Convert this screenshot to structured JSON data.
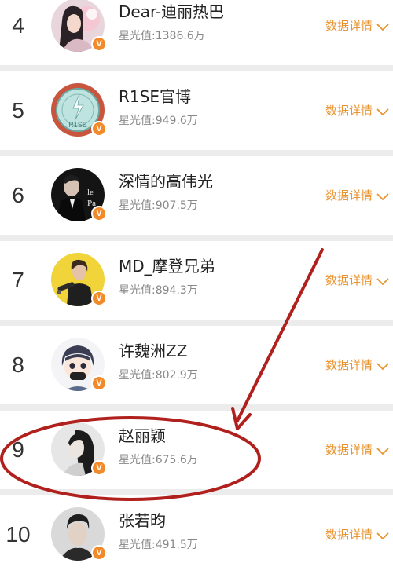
{
  "colors": {
    "accent": "#e8932e",
    "verified_badge": "#f28a2a",
    "annotation_red": "#b0201c",
    "row_bg": "#ffffff",
    "separator": "#ececec"
  },
  "list": {
    "items": [
      {
        "rank": "4",
        "name": "Dear-迪丽热巴",
        "stat_label": "星光值:",
        "stat_value": "1386.6万",
        "details_label": "数据详情",
        "verified": "V",
        "avatar_icon": "avatar-portrait-female"
      },
      {
        "rank": "5",
        "name": "R1SE官博",
        "stat_label": "星光值:",
        "stat_value": "949.6万",
        "details_label": "数据详情",
        "verified": "V",
        "avatar_icon": "avatar-logo-r1se",
        "avatar_text": "R1SE"
      },
      {
        "rank": "6",
        "name": "深情的高伟光",
        "stat_label": "星光值:",
        "stat_value": "907.5万",
        "details_label": "数据详情",
        "verified": "V",
        "avatar_icon": "avatar-poster-man"
      },
      {
        "rank": "7",
        "name": "MD_摩登兄弟",
        "stat_label": "星光值:",
        "stat_value": "894.3万",
        "details_label": "数据详情",
        "verified": "V",
        "avatar_icon": "avatar-singer-yellow"
      },
      {
        "rank": "8",
        "name": "许魏洲ZZ",
        "stat_label": "星光值:",
        "stat_value": "802.9万",
        "details_label": "数据详情",
        "verified": "V",
        "avatar_icon": "avatar-cartoon-character"
      },
      {
        "rank": "9",
        "name": "赵丽颖",
        "stat_label": "星光值:",
        "stat_value": "675.6万",
        "details_label": "数据详情",
        "verified": "V",
        "avatar_icon": "avatar-portrait-female-bw"
      },
      {
        "rank": "10",
        "name": "张若昀",
        "stat_label": "星光值:",
        "stat_value": "491.5万",
        "details_label": "数据详情",
        "verified": "V",
        "avatar_icon": "avatar-portrait-male"
      }
    ]
  },
  "annotation": {
    "highlight_rank": "9",
    "arrow_icon": "red-arrow",
    "circle_icon": "red-ellipse"
  }
}
